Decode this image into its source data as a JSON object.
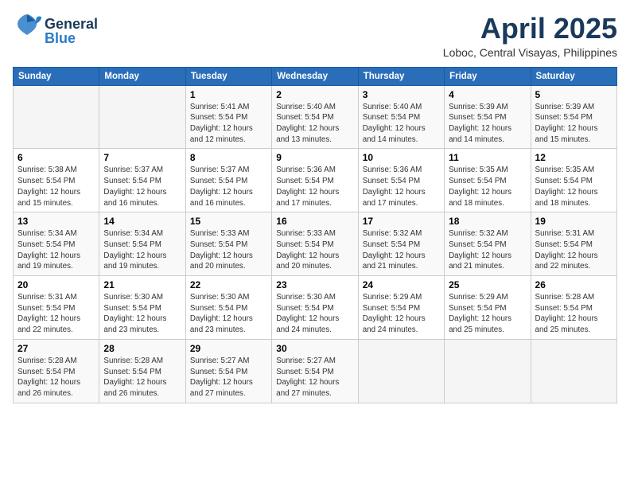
{
  "header": {
    "logo_general": "General",
    "logo_blue": "Blue",
    "month": "April 2025",
    "location": "Loboc, Central Visayas, Philippines"
  },
  "weekdays": [
    "Sunday",
    "Monday",
    "Tuesday",
    "Wednesday",
    "Thursday",
    "Friday",
    "Saturday"
  ],
  "weeks": [
    [
      {
        "day": "",
        "info": ""
      },
      {
        "day": "",
        "info": ""
      },
      {
        "day": "1",
        "info": "Sunrise: 5:41 AM\nSunset: 5:54 PM\nDaylight: 12 hours\nand 12 minutes."
      },
      {
        "day": "2",
        "info": "Sunrise: 5:40 AM\nSunset: 5:54 PM\nDaylight: 12 hours\nand 13 minutes."
      },
      {
        "day": "3",
        "info": "Sunrise: 5:40 AM\nSunset: 5:54 PM\nDaylight: 12 hours\nand 14 minutes."
      },
      {
        "day": "4",
        "info": "Sunrise: 5:39 AM\nSunset: 5:54 PM\nDaylight: 12 hours\nand 14 minutes."
      },
      {
        "day": "5",
        "info": "Sunrise: 5:39 AM\nSunset: 5:54 PM\nDaylight: 12 hours\nand 15 minutes."
      }
    ],
    [
      {
        "day": "6",
        "info": "Sunrise: 5:38 AM\nSunset: 5:54 PM\nDaylight: 12 hours\nand 15 minutes."
      },
      {
        "day": "7",
        "info": "Sunrise: 5:37 AM\nSunset: 5:54 PM\nDaylight: 12 hours\nand 16 minutes."
      },
      {
        "day": "8",
        "info": "Sunrise: 5:37 AM\nSunset: 5:54 PM\nDaylight: 12 hours\nand 16 minutes."
      },
      {
        "day": "9",
        "info": "Sunrise: 5:36 AM\nSunset: 5:54 PM\nDaylight: 12 hours\nand 17 minutes."
      },
      {
        "day": "10",
        "info": "Sunrise: 5:36 AM\nSunset: 5:54 PM\nDaylight: 12 hours\nand 17 minutes."
      },
      {
        "day": "11",
        "info": "Sunrise: 5:35 AM\nSunset: 5:54 PM\nDaylight: 12 hours\nand 18 minutes."
      },
      {
        "day": "12",
        "info": "Sunrise: 5:35 AM\nSunset: 5:54 PM\nDaylight: 12 hours\nand 18 minutes."
      }
    ],
    [
      {
        "day": "13",
        "info": "Sunrise: 5:34 AM\nSunset: 5:54 PM\nDaylight: 12 hours\nand 19 minutes."
      },
      {
        "day": "14",
        "info": "Sunrise: 5:34 AM\nSunset: 5:54 PM\nDaylight: 12 hours\nand 19 minutes."
      },
      {
        "day": "15",
        "info": "Sunrise: 5:33 AM\nSunset: 5:54 PM\nDaylight: 12 hours\nand 20 minutes."
      },
      {
        "day": "16",
        "info": "Sunrise: 5:33 AM\nSunset: 5:54 PM\nDaylight: 12 hours\nand 20 minutes."
      },
      {
        "day": "17",
        "info": "Sunrise: 5:32 AM\nSunset: 5:54 PM\nDaylight: 12 hours\nand 21 minutes."
      },
      {
        "day": "18",
        "info": "Sunrise: 5:32 AM\nSunset: 5:54 PM\nDaylight: 12 hours\nand 21 minutes."
      },
      {
        "day": "19",
        "info": "Sunrise: 5:31 AM\nSunset: 5:54 PM\nDaylight: 12 hours\nand 22 minutes."
      }
    ],
    [
      {
        "day": "20",
        "info": "Sunrise: 5:31 AM\nSunset: 5:54 PM\nDaylight: 12 hours\nand 22 minutes."
      },
      {
        "day": "21",
        "info": "Sunrise: 5:30 AM\nSunset: 5:54 PM\nDaylight: 12 hours\nand 23 minutes."
      },
      {
        "day": "22",
        "info": "Sunrise: 5:30 AM\nSunset: 5:54 PM\nDaylight: 12 hours\nand 23 minutes."
      },
      {
        "day": "23",
        "info": "Sunrise: 5:30 AM\nSunset: 5:54 PM\nDaylight: 12 hours\nand 24 minutes."
      },
      {
        "day": "24",
        "info": "Sunrise: 5:29 AM\nSunset: 5:54 PM\nDaylight: 12 hours\nand 24 minutes."
      },
      {
        "day": "25",
        "info": "Sunrise: 5:29 AM\nSunset: 5:54 PM\nDaylight: 12 hours\nand 25 minutes."
      },
      {
        "day": "26",
        "info": "Sunrise: 5:28 AM\nSunset: 5:54 PM\nDaylight: 12 hours\nand 25 minutes."
      }
    ],
    [
      {
        "day": "27",
        "info": "Sunrise: 5:28 AM\nSunset: 5:54 PM\nDaylight: 12 hours\nand 26 minutes."
      },
      {
        "day": "28",
        "info": "Sunrise: 5:28 AM\nSunset: 5:54 PM\nDaylight: 12 hours\nand 26 minutes."
      },
      {
        "day": "29",
        "info": "Sunrise: 5:27 AM\nSunset: 5:54 PM\nDaylight: 12 hours\nand 27 minutes."
      },
      {
        "day": "30",
        "info": "Sunrise: 5:27 AM\nSunset: 5:54 PM\nDaylight: 12 hours\nand 27 minutes."
      },
      {
        "day": "",
        "info": ""
      },
      {
        "day": "",
        "info": ""
      },
      {
        "day": "",
        "info": ""
      }
    ]
  ]
}
